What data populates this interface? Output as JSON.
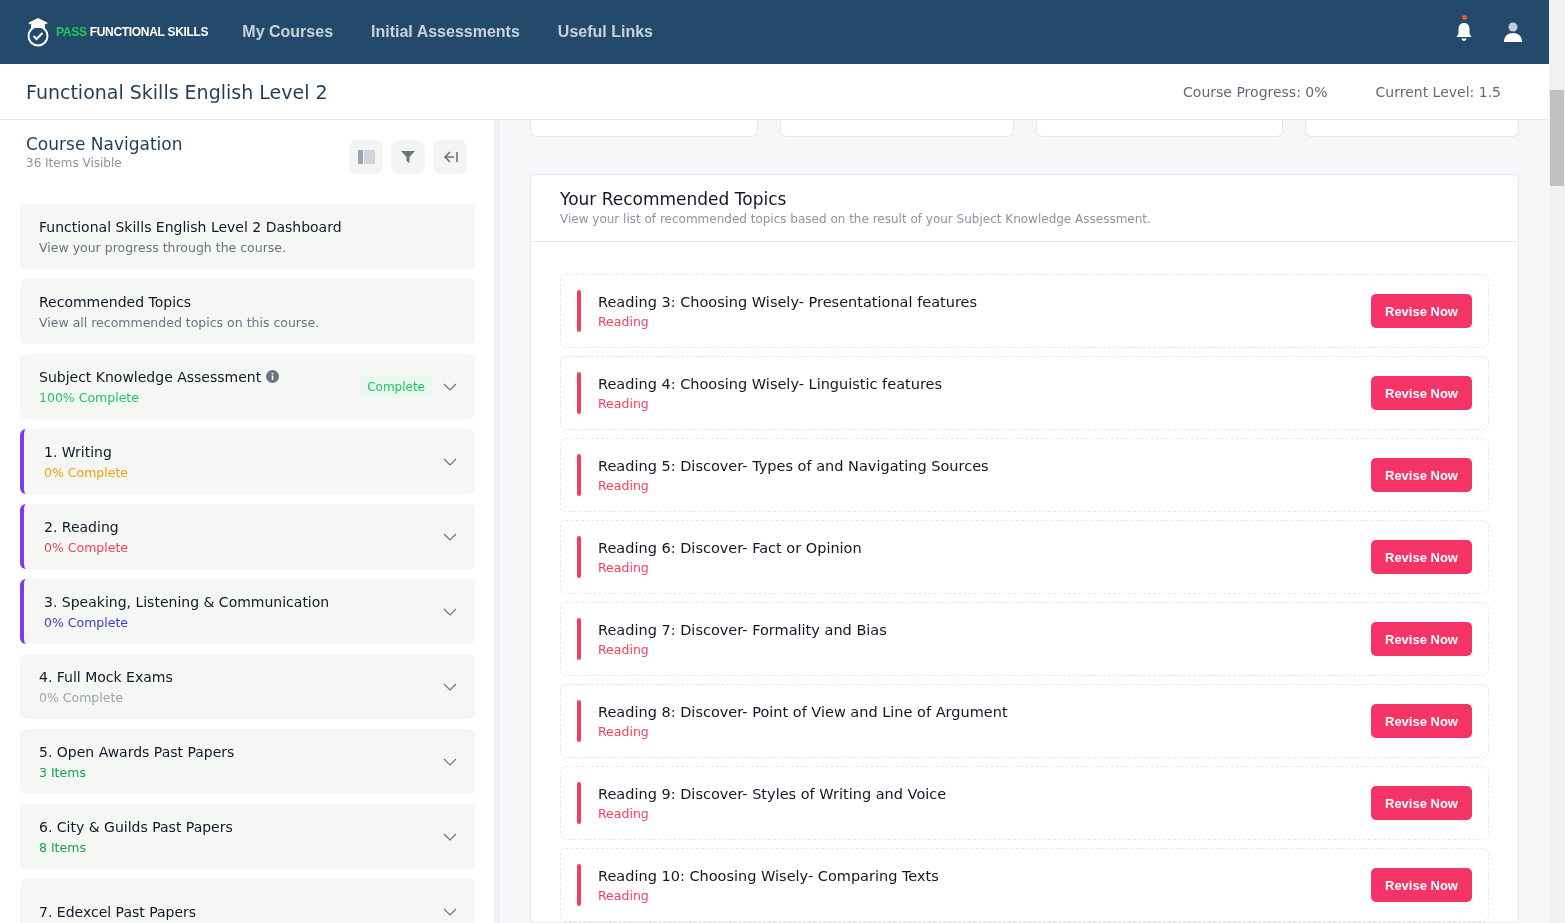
{
  "brand": {
    "accent": "PASS",
    "name": "FUNCTIONAL SKILLS"
  },
  "nav": [
    "My Courses",
    "Initial Assessments",
    "Useful Links"
  ],
  "notifications": {
    "unread": true
  },
  "course": {
    "title": "Functional Skills English Level 2",
    "progress_label": "Course Progress:",
    "progress": "0%",
    "level_label": "Current Level:",
    "level": "1.5"
  },
  "sidebar": {
    "title": "Course Navigation",
    "count": "36 Items Visible",
    "items": [
      {
        "title": "Functional Skills English Level 2 Dashboard",
        "subtitle": "View your progress through the course.",
        "color": "#6b7280",
        "accent": false,
        "expandable": false,
        "info": false
      },
      {
        "title": "Recommended Topics",
        "subtitle": "View all recommended topics on this course.",
        "color": "#6b7280",
        "accent": false,
        "expandable": false,
        "info": false
      },
      {
        "title": "Subject Knowledge Assessment",
        "subtitle": "100% Complete",
        "color": "#22c55e",
        "accent": false,
        "expandable": true,
        "info": true,
        "badge": "Complete"
      },
      {
        "title": "1. Writing",
        "subtitle": "0% Complete",
        "color": "#f59e0b",
        "accent": true,
        "expandable": true,
        "info": false
      },
      {
        "title": "2. Reading",
        "subtitle": "0% Complete",
        "color": "#f43f5e",
        "accent": true,
        "expandable": true,
        "info": false
      },
      {
        "title": "3. Speaking, Listening & Communication",
        "subtitle": "0% Complete",
        "color": "#4338ca",
        "accent": true,
        "expandable": true,
        "info": false
      },
      {
        "title": "4. Full Mock Exams",
        "subtitle": "0% Complete",
        "color": "#9ca3af",
        "accent": false,
        "expandable": true,
        "info": false
      },
      {
        "title": "5. Open Awards Past Papers",
        "subtitle": "3 Items",
        "color": "#16a34a",
        "accent": false,
        "expandable": true,
        "info": false
      },
      {
        "title": "6. City & Guilds Past Papers",
        "subtitle": "8 Items",
        "color": "#16a34a",
        "accent": false,
        "expandable": true,
        "info": false
      },
      {
        "title": "7. Edexcel Past Papers",
        "accent": false,
        "expandable": true,
        "info": false
      }
    ]
  },
  "recommended": {
    "title": "Your Recommended Topics",
    "description": "View your list of recommended topics based on the result of your Subject Knowledge Assessment.",
    "topics": [
      {
        "title": "Reading 3: Choosing Wisely- Presentational features",
        "category": "Reading",
        "action": "Revise Now"
      },
      {
        "title": "Reading 4: Choosing Wisely- Linguistic features",
        "category": "Reading",
        "action": "Revise Now"
      },
      {
        "title": "Reading 5: Discover- Types of and Navigating Sources",
        "category": "Reading",
        "action": "Revise Now"
      },
      {
        "title": "Reading 6: Discover- Fact or Opinion",
        "category": "Reading",
        "action": "Revise Now"
      },
      {
        "title": "Reading 7: Discover- Formality and Bias",
        "category": "Reading",
        "action": "Revise Now"
      },
      {
        "title": "Reading 8: Discover- Point of View and Line of Argument",
        "category": "Reading",
        "action": "Revise Now"
      },
      {
        "title": "Reading 9: Discover- Styles of Writing and Voice",
        "category": "Reading",
        "action": "Revise Now"
      },
      {
        "title": "Reading 10: Choosing Wisely- Comparing Texts",
        "category": "Reading",
        "action": "Revise Now"
      }
    ]
  }
}
